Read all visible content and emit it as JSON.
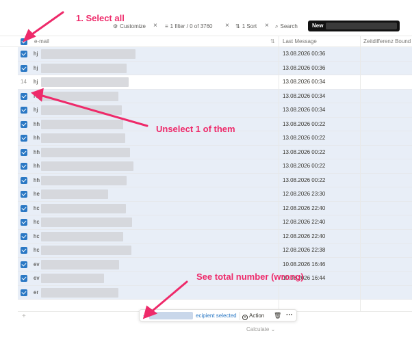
{
  "toolbar": {
    "customize": "Customize",
    "filter": "1 filter / 0 of 3760",
    "sort": "1 Sort",
    "search": "Search",
    "new": "New"
  },
  "table": {
    "columns": [
      "e-mail",
      "Last Message",
      "Zeitdifferenz Bound"
    ],
    "rows": [
      {
        "prefix": "hj",
        "date": "13.08.2026 00:36",
        "selected": true
      },
      {
        "prefix": "hj",
        "date": "13.08.2026 00:36",
        "selected": true
      },
      {
        "prefix": "hj",
        "date": "13.08.2026 00:34",
        "selected": false,
        "row_number": "14"
      },
      {
        "prefix": "H",
        "date": "13.08.2026 00:34",
        "selected": true
      },
      {
        "prefix": "hj",
        "date": "13.08.2026 00:34",
        "selected": true
      },
      {
        "prefix": "hh",
        "date": "13.08.2026 00:22",
        "selected": true
      },
      {
        "prefix": "hh",
        "date": "13.08.2026 00:22",
        "selected": true
      },
      {
        "prefix": "hh",
        "date": "13.08.2026 00:22",
        "selected": true
      },
      {
        "prefix": "hh",
        "date": "13.08.2026 00:22",
        "selected": true
      },
      {
        "prefix": "hh",
        "date": "13.08.2026 00:22",
        "selected": true
      },
      {
        "prefix": "he",
        "date": "12.08.2026 23:30",
        "selected": true
      },
      {
        "prefix": "hc",
        "date": "12.08.2026 22:40",
        "selected": true
      },
      {
        "prefix": "hc",
        "date": "12.08.2026 22:40",
        "selected": true
      },
      {
        "prefix": "hc",
        "date": "12.08.2026 22:40",
        "selected": true
      },
      {
        "prefix": "hc",
        "date": "12.08.2026 22:38",
        "selected": true
      },
      {
        "prefix": "ev",
        "date": "10.08.2026 16:46",
        "selected": true
      },
      {
        "prefix": "ev",
        "date": "10.08.2026 16:44",
        "selected": true
      },
      {
        "prefix": "er",
        "date": "",
        "selected": true
      }
    ]
  },
  "selection_bar": {
    "count_prefix": "-1",
    "text": "ecipient selected",
    "action": "Action"
  },
  "footer": {
    "calculate": "Calculate"
  },
  "annotations": {
    "select_all": "1. Select all",
    "unselect": "Unselect 1 of them",
    "total": "See total number (wrong)"
  },
  "colors": {
    "accent": "#2a78c4",
    "annotation": "#ee2a6a",
    "selected_row": "#e8eef7"
  }
}
